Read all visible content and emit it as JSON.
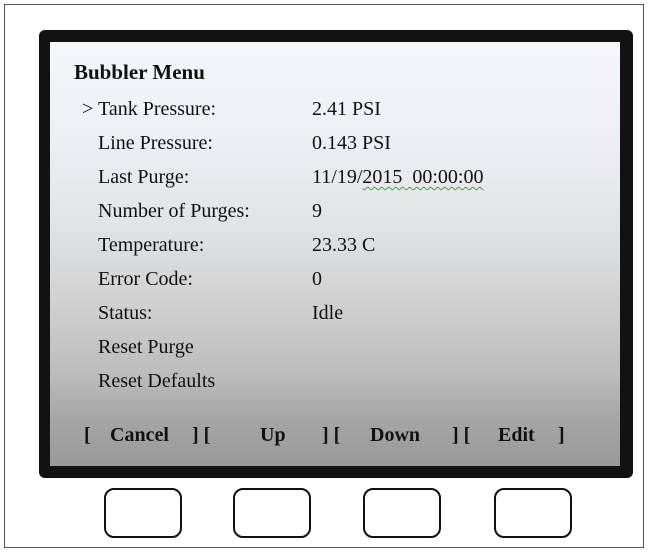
{
  "menu": {
    "title": "Bubbler Menu",
    "cursor": ">",
    "rows": [
      {
        "label": "Tank Pressure:",
        "value": "2.41 PSI"
      },
      {
        "label": "Line Pressure:",
        "value": "0.143 PSI"
      },
      {
        "label": "Last Purge:",
        "value_prefix": "11/19/",
        "value_marked": "2015  00:00:00"
      },
      {
        "label": "Number of Purges:",
        "value": "9"
      },
      {
        "label": "Temperature:",
        "value": "23.33 C"
      },
      {
        "label": "Error Code:",
        "value": "0"
      },
      {
        "label": "Status:",
        "value": "Idle"
      },
      {
        "label": "Reset Purge"
      },
      {
        "label": "Reset Defaults"
      }
    ]
  },
  "softkeys": {
    "b0": "[",
    "cancel": "Cancel",
    "b1": "] [",
    "up": "Up",
    "b2": "] [",
    "down": "Down",
    "b3": "] [",
    "edit": "Edit",
    "b4": "]"
  }
}
